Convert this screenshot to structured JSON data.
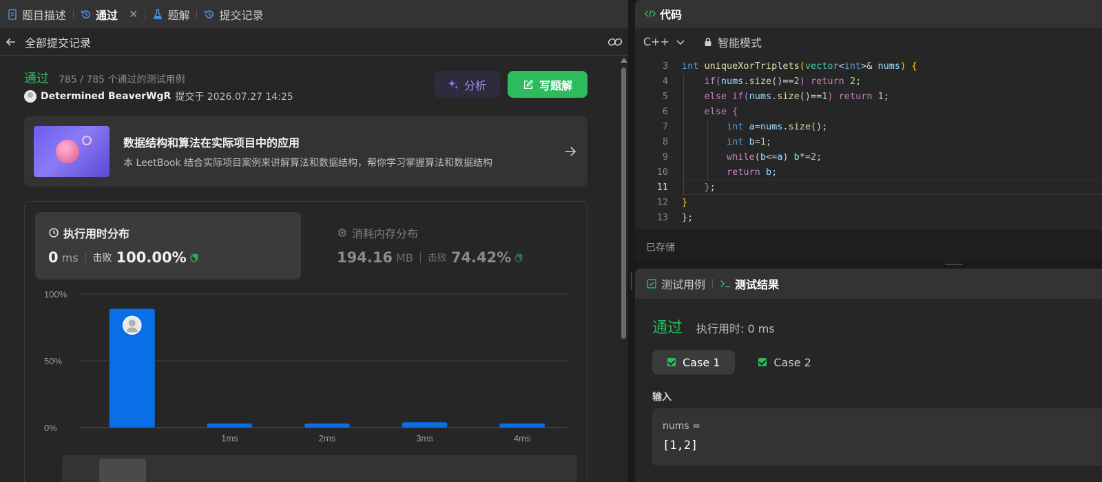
{
  "left_tabs": [
    {
      "label": "题目描述",
      "icon": "doc-icon"
    },
    {
      "label": "通过",
      "icon": "history-icon",
      "active": true
    },
    {
      "label": "题解",
      "icon": "flask-icon"
    },
    {
      "label": "提交记录",
      "icon": "history-icon"
    }
  ],
  "close_glyph": "✕",
  "subbar": {
    "title": "全部提交记录"
  },
  "submission": {
    "status": "通过",
    "cases": "785 / 785 个通过的测试用例",
    "author": "Determined BeaverWgR",
    "submitted_at": "提交于 2026.07.27 14:25"
  },
  "buttons": {
    "analyze": "分析",
    "write_solution": "写题解"
  },
  "leetbook": {
    "title": "数据结构和算法在实际项目中的应用",
    "desc": "本 LeetBook 结合实际项目案例来讲解算法和数据结构，帮你学习掌握算法和数据结构"
  },
  "runtime": {
    "title": "执行用时分布",
    "value": "0",
    "unit": "ms",
    "beat_label": "击败",
    "beat_value": "100.00%"
  },
  "memory": {
    "title": "消耗内存分布",
    "value": "194.16",
    "unit": "MB",
    "beat_label": "击败",
    "beat_value": "74.42%"
  },
  "chart_data": {
    "type": "bar",
    "categories": [
      "",
      "1ms",
      "2ms",
      "3ms",
      "4ms"
    ],
    "values": [
      89,
      3,
      3,
      4,
      3
    ],
    "ylim": [
      0,
      100
    ],
    "yticks": [
      "0%",
      "50%",
      "100%"
    ],
    "highlight_index": 0,
    "colors": {
      "bar": "#0a6fe6",
      "grid": "#444444",
      "axis_text": "#9a9a9a"
    }
  },
  "code_panel": {
    "title": "代码",
    "language": "C++",
    "mode": "智能模式",
    "saved": "已存储",
    "current_line": 11
  },
  "test_panel": {
    "tab_cases": "测试用例",
    "tab_result": "测试结果",
    "status": "通过",
    "runtime": "执行用时: 0 ms",
    "cases": [
      "Case 1",
      "Case 2"
    ],
    "input_label": "输入",
    "input_name": "nums =",
    "input_value": "[1,2]"
  },
  "colors": {
    "accent_green": "#2cbb5d",
    "accent_blue": "#0a6fe6",
    "accent_purple": "#a58ef5"
  }
}
